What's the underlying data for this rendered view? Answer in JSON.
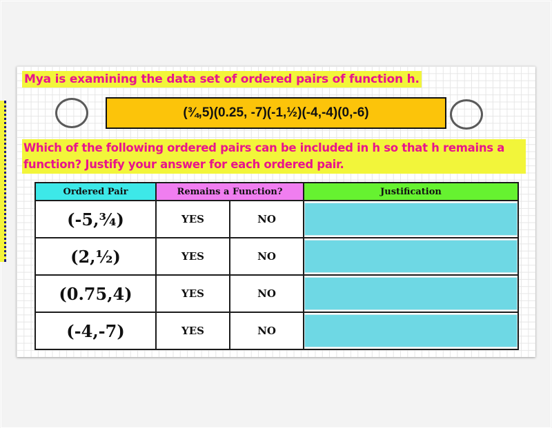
{
  "slide": {
    "title": "Mya is examining the data set of ordered pairs of function h.",
    "data_set": "(¾,5)(0.25, -7)(-1,½)(-4,-4)(0,-6)",
    "question": "Which of the following ordered pairs can be included in h so that h remains a function? Justify your answer for each ordered pair."
  },
  "table": {
    "headers": {
      "ordered_pair": "Ordered Pair",
      "remains_function": "Remains a Function?",
      "justification": "Justification"
    },
    "rows": [
      {
        "pair": "(-5,¾)",
        "yes": "YES",
        "no": "NO",
        "justification": ""
      },
      {
        "pair": "(2,½)",
        "yes": "YES",
        "no": "NO",
        "justification": ""
      },
      {
        "pair": "(0.75,4)",
        "yes": "YES",
        "no": "NO",
        "justification": ""
      },
      {
        "pair": "(-4,-7)",
        "yes": "YES",
        "no": "NO",
        "justification": ""
      }
    ]
  },
  "colors": {
    "title_text": "#e8148c",
    "highlight": "#f2f53a",
    "data_box": "#fcc40a",
    "header_pair": "#3de8e8",
    "header_function": "#f07ef0",
    "header_justification": "#66f230",
    "justification_box": "#6ed8e4"
  }
}
